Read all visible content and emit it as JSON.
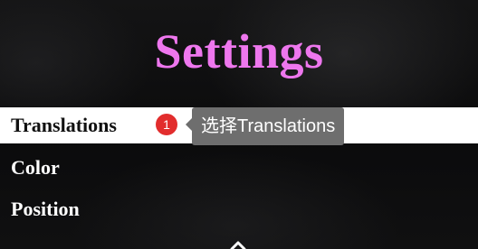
{
  "settings": {
    "title": "Settings",
    "menu_items": [
      {
        "label": "Translations",
        "selected": true
      },
      {
        "label": "Color",
        "selected": false
      },
      {
        "label": "Position",
        "selected": false
      }
    ]
  },
  "guide": {
    "step_number": "1",
    "tooltip_text": "选择Translations",
    "badge_color": "#e22d2d"
  },
  "colors": {
    "title": "#ee77ee",
    "selected_row_bg": "#ffffff",
    "tooltip_bg": "#6e6e6e"
  },
  "icons": {
    "scroll_indicator": "chevron-up-icon"
  }
}
